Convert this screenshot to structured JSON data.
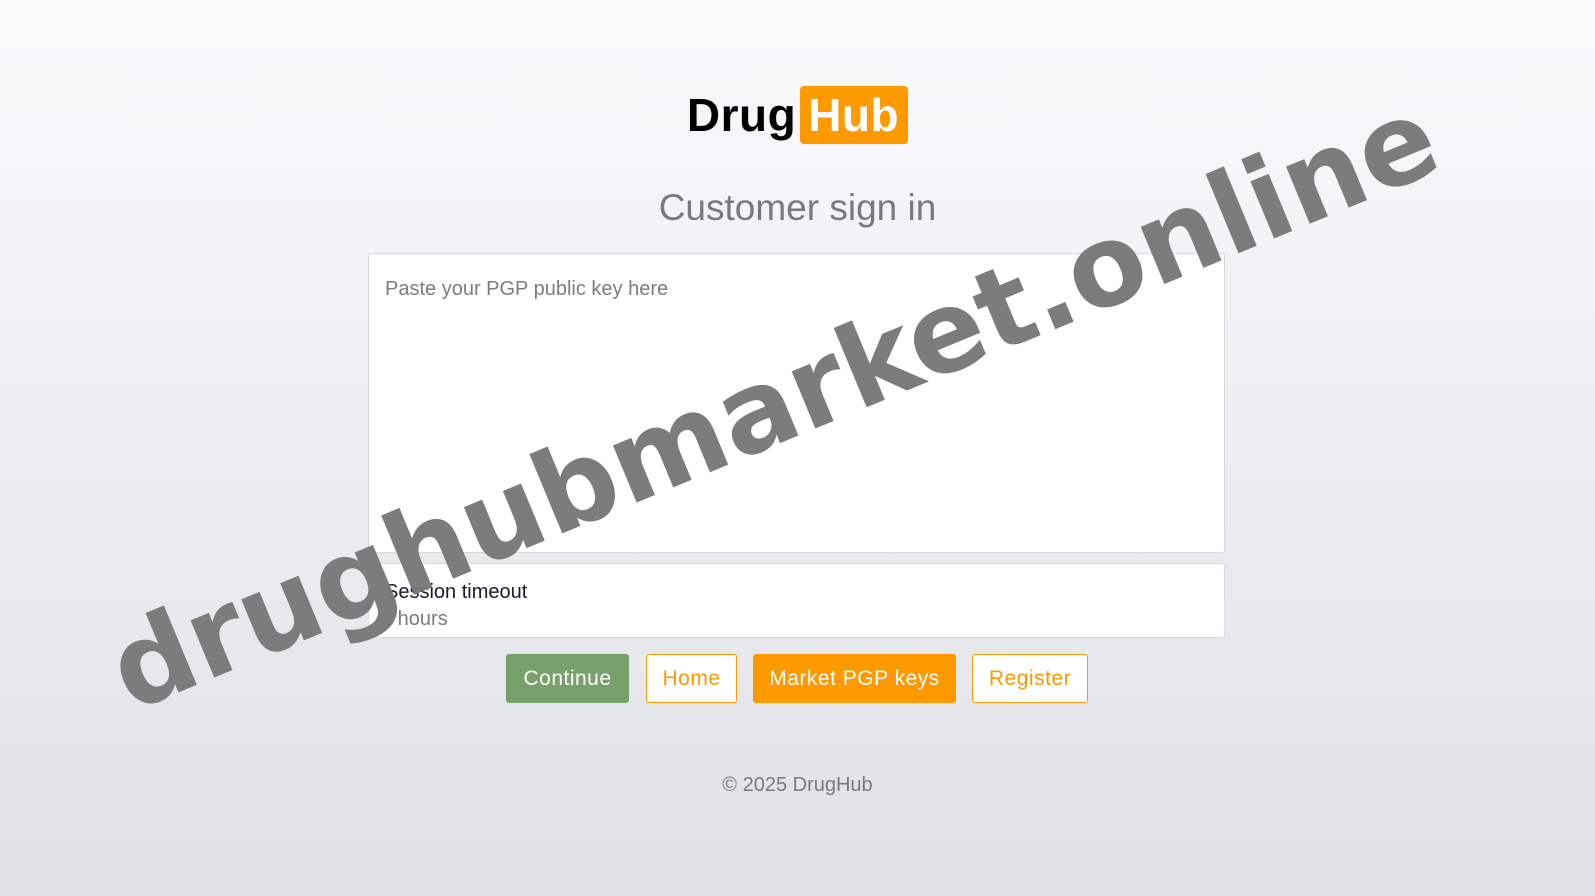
{
  "brand": {
    "part1": "Drug",
    "part2": "Hub",
    "accent_color": "#ff9900"
  },
  "page_title": "Customer sign in",
  "pgp_input": {
    "placeholder": "Paste your PGP public key here",
    "value": ""
  },
  "session_timeout": {
    "label": "Session timeout",
    "selected": "2 hours"
  },
  "buttons": {
    "continue": "Continue",
    "home": "Home",
    "market_pgp_keys": "Market PGP keys",
    "register": "Register"
  },
  "button_colors": {
    "continue": "#77a06a",
    "primary": "#ff9900"
  },
  "footer": "© 2025 DrugHub",
  "watermark": "drughubmarket.online"
}
